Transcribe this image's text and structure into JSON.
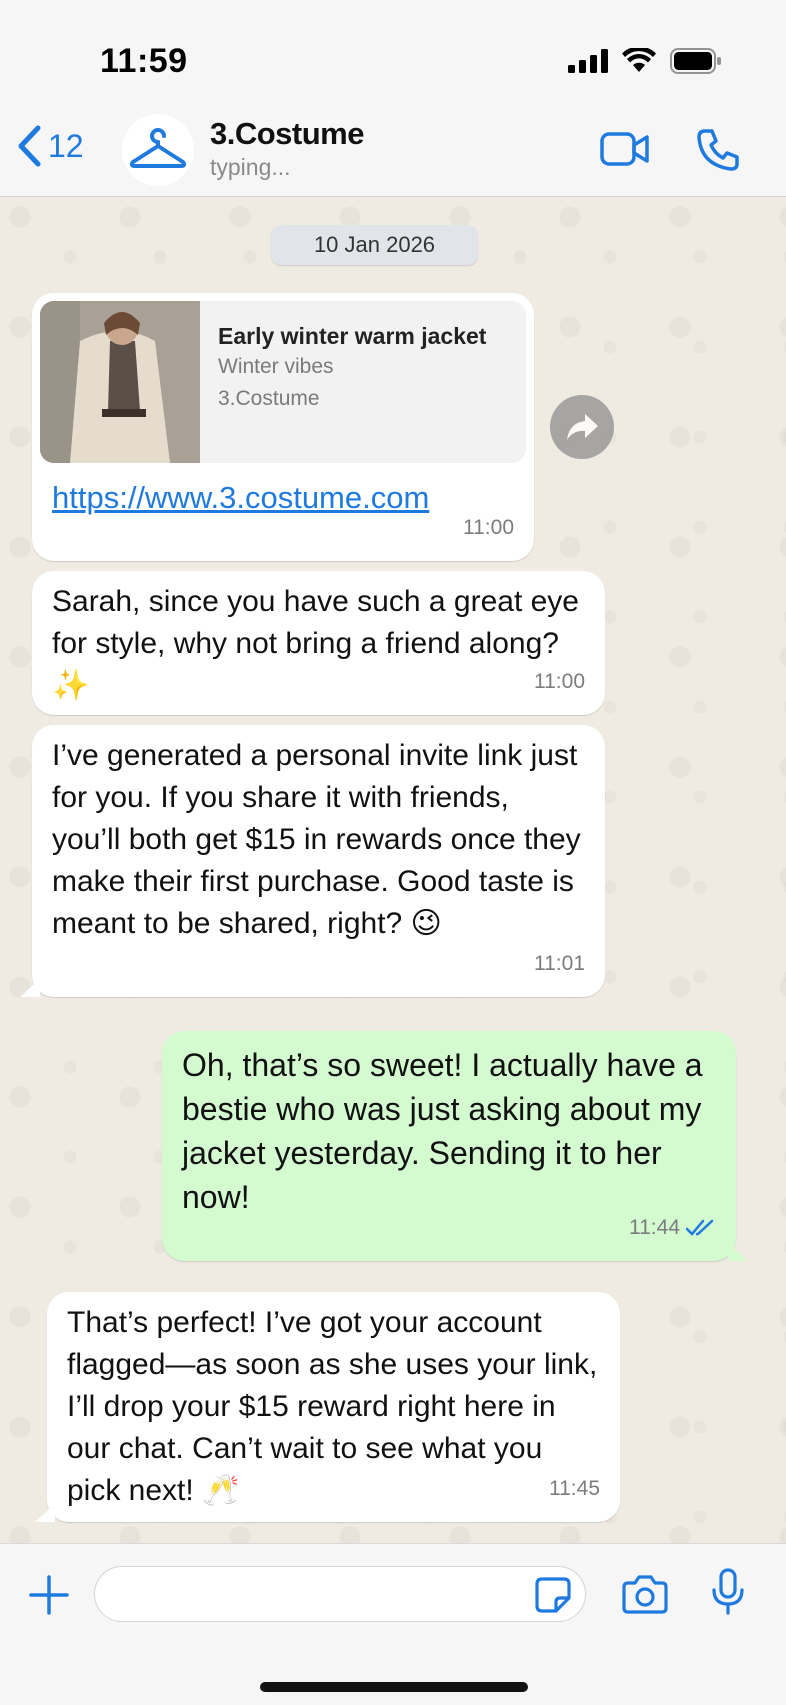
{
  "status_bar": {
    "time": "11:59"
  },
  "header": {
    "back_count": "12",
    "chat_name": "3.Costume",
    "chat_status": "typing..."
  },
  "chat": {
    "date_label": "10 Jan 2026",
    "link_preview": {
      "title": "Early winter warm jacket",
      "subtitle": "Winter vibes",
      "site": "3.Costume",
      "url": "https://www.3.costume.com",
      "time": "11:00"
    },
    "messages": [
      {
        "direction": "in",
        "text": "Sarah, since you have such a great eye for style, why not bring a friend along? ✨",
        "time": "11:00"
      },
      {
        "direction": "in",
        "text": "I’ve generated a personal invite link just for you. If you share it with friends, you’ll both get $15 in rewards once they make their first purchase. Good taste is meant to be shared, right? 😉",
        "time": "11:01"
      },
      {
        "direction": "out",
        "text": "Oh, that’s so sweet! I actually have a bestie who was just asking about my jacket yesterday. Sending it to her now!",
        "time": "11:44",
        "status": "read"
      },
      {
        "direction": "in",
        "text": "That’s perfect! I’ve got your account flagged—as soon as she uses your link, I’ll drop your $15 reward right here in our chat. Can’t wait to see what you pick next! 🥂",
        "time": "11:45"
      }
    ]
  },
  "input_bar": {
    "placeholder": "",
    "value": ""
  },
  "colors": {
    "accent": "#1f7ae0",
    "outgoing_bubble": "#d4fad0",
    "incoming_bubble": "#ffffff",
    "chat_background": "#efeae2"
  },
  "icons": [
    "signal-icon",
    "wifi-icon",
    "battery-icon",
    "back-chevron-icon",
    "hanger-icon",
    "video-call-icon",
    "phone-call-icon",
    "forward-icon",
    "read-receipt-icon",
    "plus-icon",
    "sticker-icon",
    "camera-icon",
    "microphone-icon"
  ]
}
